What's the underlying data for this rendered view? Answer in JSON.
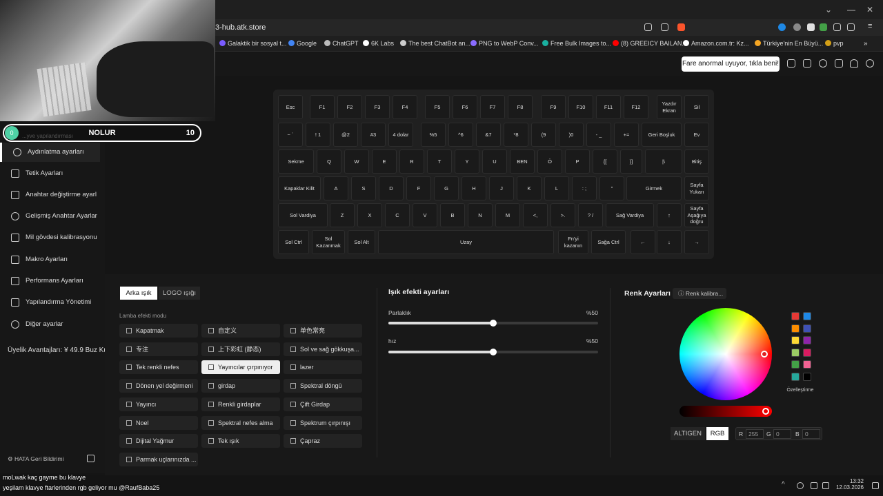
{
  "browser": {
    "url": "3-hub.atk.store",
    "tab_close": "|",
    "new_tab": "+"
  },
  "bookmarks": [
    {
      "label": "Galaktik bir sosyal t...",
      "color": "#7a5cff"
    },
    {
      "label": "Google",
      "color": "#4285f4"
    },
    {
      "label": "ChatGPT",
      "color": "#bbbbbb"
    },
    {
      "label": "6K Labs",
      "color": "#ffffff"
    },
    {
      "label": "The best ChatBot an...",
      "color": "#cccccc"
    },
    {
      "label": "PNG to WebP Conv...",
      "color": "#8a6cff"
    },
    {
      "label": "Free Bulk Images to...",
      "color": "#1ab0a0"
    },
    {
      "label": "(8) GREEICY BAILAN...",
      "color": "#ff0000"
    },
    {
      "label": "Amazon.com.tr: Kz...",
      "color": "#ffffff"
    },
    {
      "label": "Türkiye'nin En Büyü...",
      "color": "#f5a623"
    },
    {
      "label": "pvp",
      "color": "#d4a017"
    }
  ],
  "toast": "Fare anormal uyuyor, tıkla beni!",
  "stream": {
    "title": "NOLUR",
    "count": "10",
    "start": "0",
    "sub": "...yve yapılandırması"
  },
  "sidebar": {
    "items": [
      {
        "label": "Aydınlatma ayarları",
        "icon": "sun-icon"
      },
      {
        "label": "Tetik Ayarları",
        "icon": "trigger-icon"
      },
      {
        "label": "Anahtar değiştirme ayarl",
        "icon": "keyboard-icon"
      },
      {
        "label": "Gelişmiş Anahtar Ayarlar",
        "icon": "key-advanced-icon"
      },
      {
        "label": "Mil gövdesi kalibrasyonu",
        "icon": "calibration-icon"
      },
      {
        "label": "Makro Ayarları",
        "icon": "macro-icon"
      },
      {
        "label": "Performans Ayarları",
        "icon": "performance-icon"
      },
      {
        "label": "Yapılandırma Yönetimi",
        "icon": "grid-icon"
      },
      {
        "label": "Diğer ayarlar",
        "icon": "gear-icon"
      }
    ],
    "membership": "Üyelik Avantajları: ¥ 49.9 Buz Ku.",
    "feedback": "HATA Geri Bildirimi"
  },
  "keys": [
    [
      "Esc",
      "F1",
      "F2",
      "F3",
      "F4",
      "F5",
      "F6",
      "F7",
      "F8",
      "F9",
      "F10",
      "F11",
      "F12",
      "Yazdır Ekran",
      "Sil"
    ],
    [
      "~ `",
      "! 1",
      "@2",
      "#3",
      "4 dolar",
      "%5",
      "^6",
      "&7",
      "*8",
      "(9",
      ")0",
      "- _",
      "+=",
      "Geri Boşluk",
      "Ev"
    ],
    [
      "Sekme",
      "Q",
      "W",
      "E",
      "R",
      "T",
      "Y",
      "U",
      "BEN",
      "Ö",
      "P",
      "{[",
      "}]",
      "|\\",
      "Bitiş"
    ],
    [
      "Kapaklar Kilit",
      "A",
      "S",
      "D",
      "F",
      "G",
      "H",
      "J",
      "K",
      "L",
      ": ;",
      "\"",
      "Girmek",
      "Sayfa Yukarı"
    ],
    [
      "Sol Vardiya",
      "Z",
      "X",
      "C",
      "V",
      "B",
      "N",
      "M",
      "<,",
      ">.",
      "? /",
      "Sağ Vardiya",
      "↑",
      "Sayfa Aşağıya doğru"
    ],
    [
      "Sol Ctrl",
      "Sol Kazanmak",
      "Sol Alt",
      "Uzay",
      "Fn'yi kazanın",
      "Sağa Ctrl",
      "←",
      "↓",
      "→"
    ]
  ],
  "lighting": {
    "tabs": [
      "Arka ışık",
      "LOGO ışığı"
    ],
    "mode_label": "Lamba efekti modu",
    "effects": [
      "Kapatmak",
      "自定义",
      "单色常亮",
      "专注",
      "上下彩虹 (静态)",
      "Sol ve sağ gökkuşa...",
      "Tek renkli nefes",
      "Yayıncılar çırpınıyor",
      "lazer",
      "Dönen yel değirmeni",
      "girdap",
      "Spektral döngü",
      "Yayıncı",
      "Renkli girdaplar",
      "Çift Girdap",
      "Noel",
      "Spektral nefes alma",
      "Spektrum çırpınışı",
      "Dijital Yağmur",
      "Tek ışık",
      "Çapraz",
      "Parmak uçlarınızda ..."
    ],
    "selected_effect": "Yayıncılar çırpınıyor"
  },
  "effect_settings": {
    "title": "Işık efekti ayarları",
    "sliders": [
      {
        "label": "Parlaklık",
        "value": "%50",
        "fraction": 0.5
      },
      {
        "label": "hız",
        "value": "%50",
        "fraction": 0.5
      }
    ]
  },
  "color": {
    "title": "Renk Ayarları",
    "calib": "Renk kalibra...",
    "custom": "Özelleştirme",
    "mode_buttons": [
      "ALTIGEN",
      "RGB"
    ],
    "active_mode": "RGB",
    "r_label": "R",
    "r": "255",
    "g_label": "G",
    "g": "0",
    "b_label": "B",
    "b": "0",
    "swatches": [
      "#e53935",
      "#1e88e5",
      "#fb8c00",
      "#3f51b5",
      "#fdd835",
      "#8e24aa",
      "#9ccc65",
      "#d81b60",
      "#43a047",
      "#f06292",
      "#26a69a",
      "#000000"
    ]
  },
  "chat": [
    {
      "user": "moLwak",
      "text": "kaç gayme bu klavye"
    },
    {
      "user": "yeşilam",
      "text": "klavye ftarlerinden rgb geliyor mu @RaufBaba25"
    }
  ],
  "clock": {
    "time": "13:32",
    "date": "12.03.2026"
  }
}
